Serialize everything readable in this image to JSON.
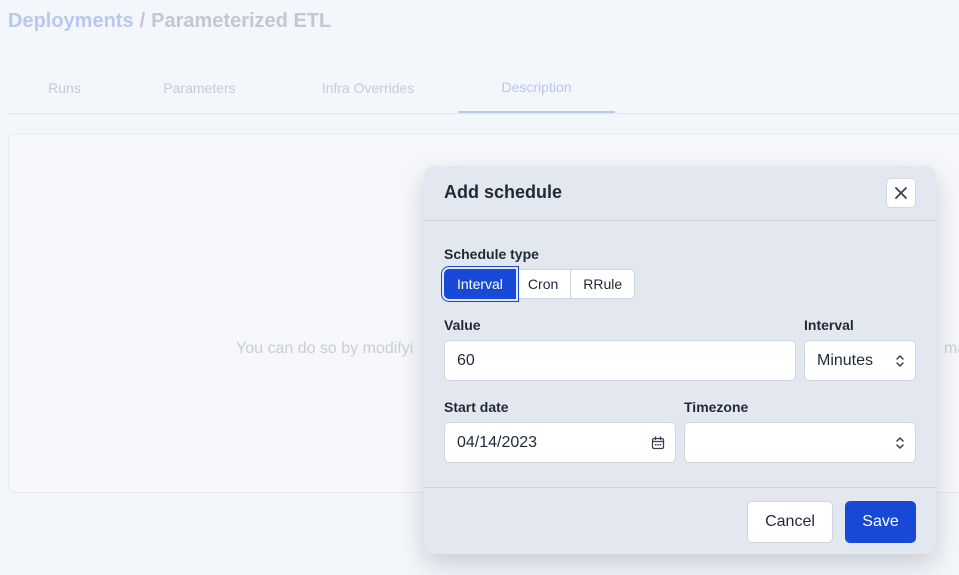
{
  "breadcrumb": {
    "parent": "Deployments",
    "separator": "/",
    "current": "Parameterized ETL"
  },
  "tabs": [
    {
      "label": "Runs"
    },
    {
      "label": "Parameters"
    },
    {
      "label": "Infra Overrides"
    },
    {
      "label": "Description",
      "active": true
    }
  ],
  "panel": {
    "text": "You can do so by modifyi",
    "text_right": "ma"
  },
  "modal": {
    "title": "Add schedule",
    "schedule_type": {
      "label": "Schedule type",
      "options": [
        "Interval",
        "Cron",
        "RRule"
      ],
      "selected": "Interval"
    },
    "value": {
      "label": "Value",
      "value": "60"
    },
    "interval": {
      "label": "Interval",
      "value": "Minutes"
    },
    "start_date": {
      "label": "Start date",
      "value": "04/14/2023"
    },
    "timezone": {
      "label": "Timezone",
      "value": ""
    },
    "cancel_label": "Cancel",
    "save_label": "Save"
  },
  "colors": {
    "primary": "#1849d6",
    "modal_bg": "#e3e8f0",
    "page_bg": "#f3f6fa"
  },
  "icons": {
    "close": "close-icon",
    "calendar": "calendar-icon",
    "select": "chevron-up-down-icon"
  }
}
